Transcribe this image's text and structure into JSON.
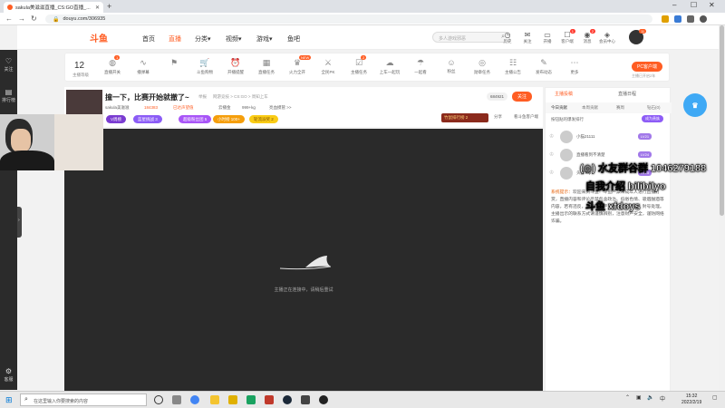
{
  "browser": {
    "tab_title": "sakula美滋滋直播_CS:GO直播_...",
    "url": "douyu.com/306935",
    "new_tab": "+",
    "controls": {
      "min": "–",
      "max": "☐",
      "close": "✕"
    }
  },
  "rail": {
    "items": [
      {
        "icon": "♡",
        "label": "关注"
      },
      {
        "icon": "▤",
        "label": "排行榜"
      },
      {
        "icon": "⚙",
        "label": "客服"
      }
    ]
  },
  "topnav": {
    "logo": "斗鱼",
    "links": [
      "首页",
      "直播",
      "分类▾",
      "视频▾",
      "游戏▾",
      "鱼吧"
    ],
    "active_index": 1,
    "search_placeholder": "多人游戏邪恶",
    "header_icons": [
      {
        "icon": "◷",
        "label": "历史",
        "badge": ""
      },
      {
        "icon": "✉",
        "label": "关注",
        "badge": ""
      },
      {
        "icon": "▭",
        "label": "开播",
        "badge": ""
      },
      {
        "icon": "☐",
        "label": "客户端",
        "badge": "1"
      },
      {
        "icon": "◉",
        "label": "消息",
        "badge": "2"
      },
      {
        "icon": "◈",
        "label": "会员中心",
        "badge": ""
      }
    ],
    "avatar_badge": "11"
  },
  "toolbar": {
    "level": "12",
    "level_label": "主播等级",
    "items": [
      {
        "icon": "◍",
        "label": "直播开关",
        "badge": "1"
      },
      {
        "icon": "∿",
        "label": "播弹幕",
        "badge": ""
      },
      {
        "icon": "⚑",
        "label": "",
        "badge": ""
      },
      {
        "icon": "🛒",
        "label": "斗鱼购物",
        "badge": ""
      },
      {
        "icon": "⏰",
        "label": "开播提醒",
        "badge": ""
      },
      {
        "icon": "▦",
        "label": "直播任务",
        "badge": ""
      },
      {
        "icon": "♛",
        "label": "火力全开",
        "badge": "NEW"
      },
      {
        "icon": "⚔",
        "label": "全民PK",
        "badge": ""
      },
      {
        "icon": "☑",
        "label": "主播任务",
        "badge": "2"
      },
      {
        "icon": "☁",
        "label": "上车一起玩",
        "badge": ""
      },
      {
        "icon": "☂",
        "label": "一起看",
        "badge": ""
      },
      {
        "icon": "☺",
        "label": "粉丝",
        "badge": ""
      },
      {
        "icon": "◎",
        "label": "勋章任务",
        "badge": ""
      },
      {
        "icon": "☷",
        "label": "主播公告",
        "badge": ""
      },
      {
        "icon": "✎",
        "label": "发布动态",
        "badge": ""
      },
      {
        "icon": "⋯",
        "label": "更多",
        "badge": ""
      }
    ],
    "pc_button": "PC客户端",
    "pc_sub": "主播已开启2年"
  },
  "room": {
    "title": "撞一下，比赛开始就撤了~",
    "tags": [
      "举报",
      "网游竞技 > CS:GO > 周知上车"
    ],
    "anchor": "sakula美滋滋",
    "hot": "184383",
    "rank_tag": "已达声望值",
    "meta": [
      "云播金",
      "999+kg",
      "亮血摸管 >>"
    ],
    "fans_count": "684921",
    "follow": "关注",
    "pills": [
      {
        "text": "V周榜",
        "color": "#7a3cd1"
      },
      {
        "text": "蓝星挑战 3",
        "color": "#8b5cf6"
      },
      {
        "text": "超级粉丝团 5",
        "color": "#a855f7"
      },
      {
        "text": "小时榜 100+",
        "color": "#f59e0b"
      },
      {
        "text": "轮流派奖 2",
        "color": "#facc15"
      }
    ],
    "rank_chip": "竹鼠排行榜 2",
    "share": "分享",
    "client": "看斗鱼客户端"
  },
  "player": {
    "loading_text": "主播正在连接中，请稍后重试"
  },
  "panel": {
    "tabs": [
      "主播投稿",
      "直播日程"
    ],
    "subtabs": [
      "今日贡献",
      "本周贡献",
      "赛周",
      "钻石(0)"
    ],
    "rank_title": "按钮贴的爆发排行",
    "rank_badge": "成为贵族",
    "rows": [
      {
        "name": "小猫21111",
        "level": "LV21"
      },
      {
        "name": "直播看到不清楚",
        "level": "LV24"
      },
      {
        "name": "头像Top",
        "level": "LV15"
      }
    ],
    "notice_label": "系统提示：",
    "notice_text": "欢迎来到斗鱼！斗鱼严禁未成年人进行直播打赏，直播内容和评论严禁包含政治、低俗色情、吸烟酗酒等内容，若有违反，将视情节严重程度给予禁言、封号处理。主播出示的联系方式请谨慎辨别，注意财产安全，谨防网络诈骗。"
  },
  "overlay": {
    "line1": "(◎) 水友群谷群 1046279188",
    "line2": "自我介绍 bilibilyo",
    "line3": "斗鱼 xfdoys"
  },
  "taskbar": {
    "search_placeholder": "在这里输入你要搜索的内容",
    "time": "15:32",
    "date": "2022/2/19"
  }
}
